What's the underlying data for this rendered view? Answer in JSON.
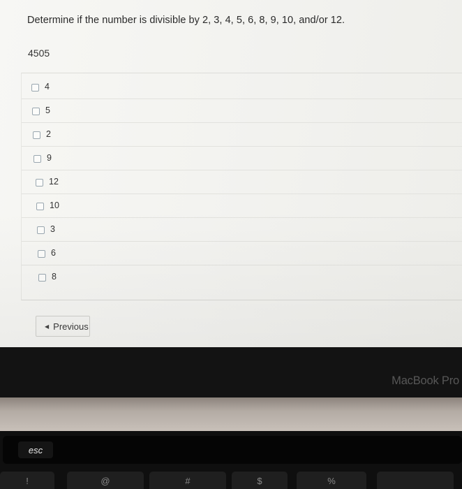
{
  "question": {
    "text": "Determine if the number is divisible by 2, 3, 4, 5, 6, 8, 9, 10, and/or 12.",
    "number": "4505"
  },
  "options": [
    {
      "label": "4",
      "checked": false
    },
    {
      "label": "5",
      "checked": false
    },
    {
      "label": "2",
      "checked": false
    },
    {
      "label": "9",
      "checked": false
    },
    {
      "label": "12",
      "checked": false
    },
    {
      "label": "10",
      "checked": false
    },
    {
      "label": "3",
      "checked": false
    },
    {
      "label": "6",
      "checked": false
    },
    {
      "label": "8",
      "checked": false
    }
  ],
  "navigation": {
    "previous_label": "Previous"
  },
  "device": {
    "brand": "MacBook Pro",
    "esc_label": "esc",
    "keys": [
      "!",
      "@",
      "#",
      "$",
      "%"
    ]
  },
  "colors": {
    "screen_background": "#f5f5f2",
    "text": "#2a2a2a",
    "checkbox_border": "#9aa7b0",
    "bezel": "#131313"
  }
}
